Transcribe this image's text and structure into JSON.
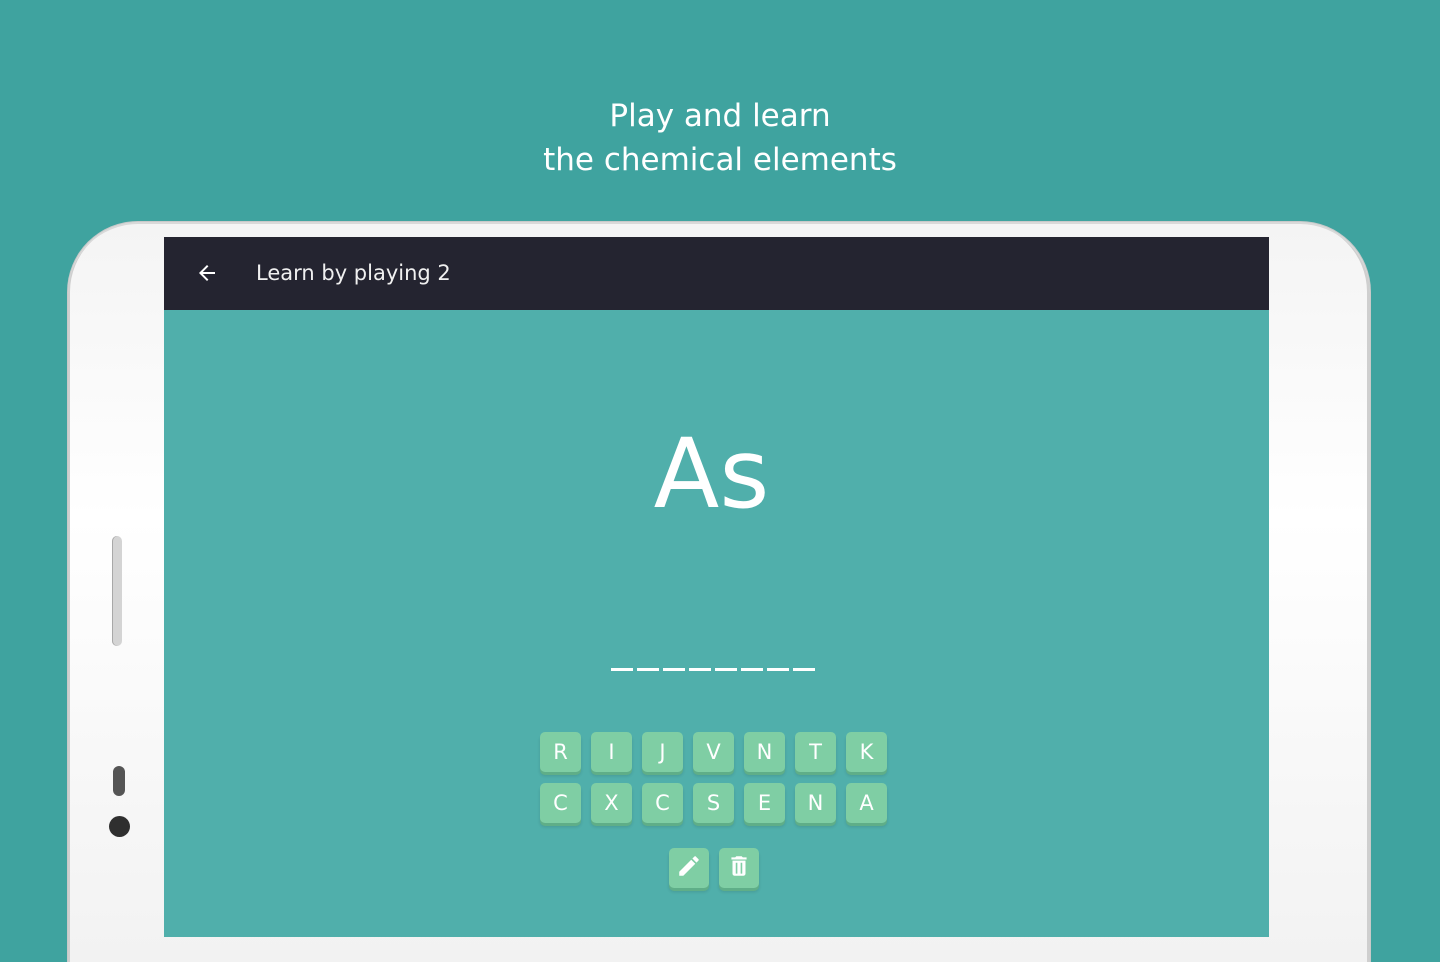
{
  "promo": {
    "line1": "Play and learn",
    "line2": "the chemical elements"
  },
  "appbar": {
    "title": "Learn by playing 2",
    "back_icon": "arrow-left-icon"
  },
  "game": {
    "symbol": "As",
    "answer_slots": 8,
    "letter_rows": [
      [
        "R",
        "I",
        "J",
        "V",
        "N",
        "T",
        "K"
      ],
      [
        "C",
        "X",
        "C",
        "S",
        "E",
        "N",
        "A"
      ]
    ],
    "tools": [
      "pencil-icon",
      "trash-icon"
    ]
  },
  "colors": {
    "background": "#3fa39f",
    "screen": "#50afab",
    "appbar": "#242430",
    "key": "#7fcea4"
  }
}
